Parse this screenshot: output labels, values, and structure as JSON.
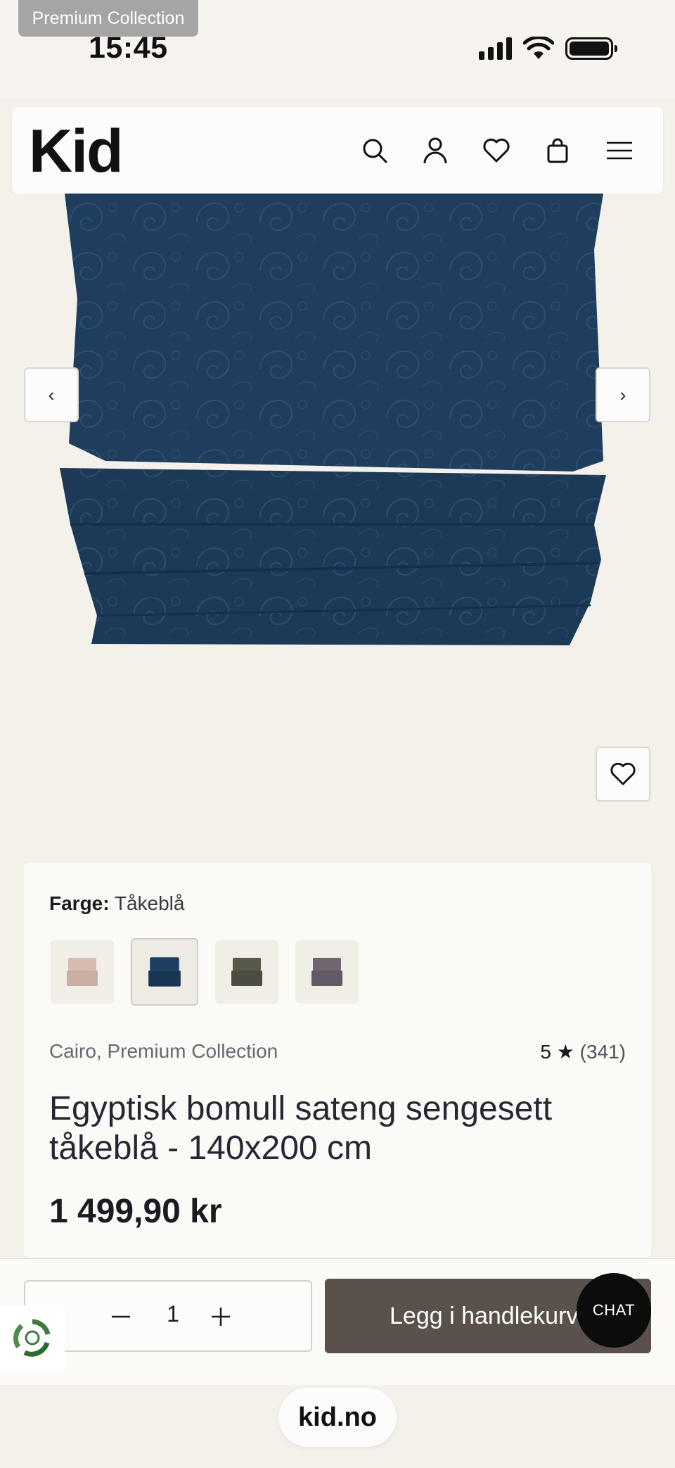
{
  "status_bar": {
    "tooltip": "Premium Collection",
    "time": "15:45",
    "icons": [
      "cellular-signal-icon",
      "wifi-icon",
      "battery-icon"
    ]
  },
  "header": {
    "logo": "Kid",
    "icons": [
      "search-icon",
      "account-icon",
      "wishlist-heart-icon",
      "shopping-bag-icon",
      "menu-icon"
    ]
  },
  "gallery": {
    "prev_label": "‹",
    "next_label": "›",
    "image_color": "#1f3e5e"
  },
  "product": {
    "color_label": "Farge:",
    "color_value": "Tåkeblå",
    "swatches": [
      {
        "name": "rosa",
        "color": "#d4bcae"
      },
      {
        "name": "tåkeblå",
        "color": "#1e3f60",
        "selected": true
      },
      {
        "name": "grønn",
        "color": "#57594a"
      },
      {
        "name": "lilla",
        "color": "#6f6670"
      }
    ],
    "collection": "Cairo, Premium Collection",
    "rating_value": "5 ★",
    "rating_count": "(341)",
    "title": "Egyptisk bomull sateng sengesett tåkeblå - 140x200 cm",
    "price": "1 499,90 kr"
  },
  "cart_bar": {
    "quantity": "1",
    "add_to_cart": "Legg i handlekurv",
    "chat": "CHAT"
  },
  "browser": {
    "url": "kid.no"
  },
  "colors": {
    "background": "#f4f0ea",
    "button_dark": "#5a524a",
    "product_blue": "#1f3e5e"
  }
}
